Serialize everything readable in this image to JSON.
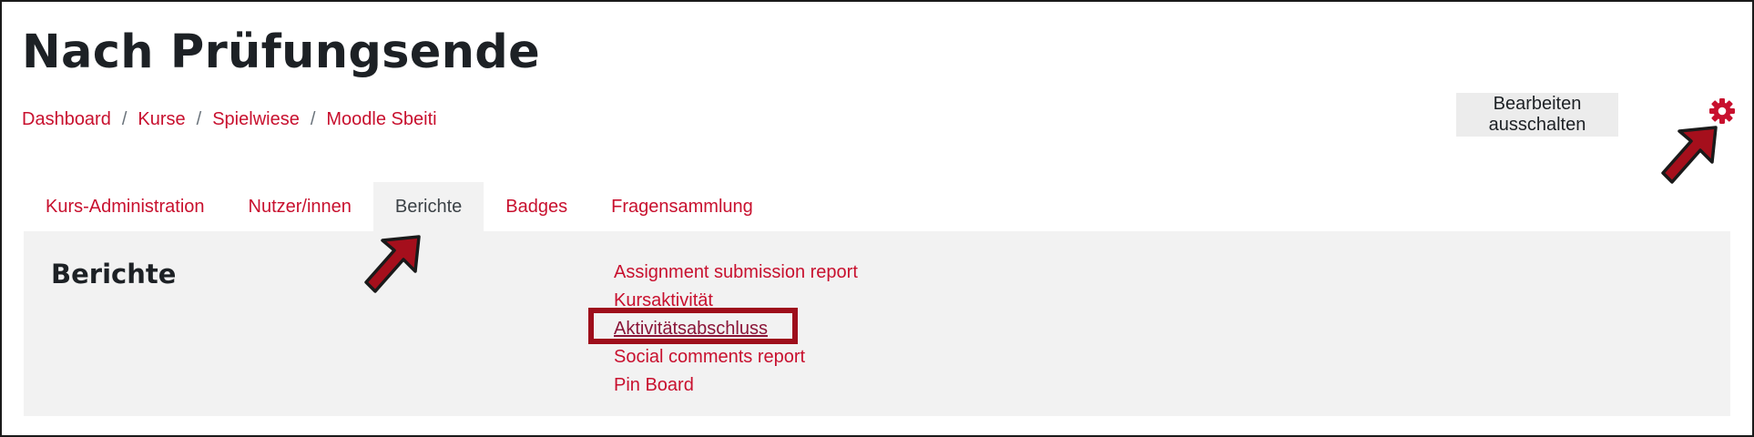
{
  "header": {
    "title": "Nach Prüfungsende"
  },
  "breadcrumb": [
    {
      "label": "Dashboard"
    },
    {
      "label": "Kurse"
    },
    {
      "label": "Spielwiese"
    },
    {
      "label": "Moodle Sbeiti"
    }
  ],
  "breadcrumb_separator": "/",
  "actions": {
    "edit_label": "Bearbeiten ausschalten",
    "settings_icon": "gear-icon"
  },
  "tabs": [
    {
      "label": "Kurs-Administration",
      "active": false
    },
    {
      "label": "Nutzer/innen",
      "active": false
    },
    {
      "label": "Berichte",
      "active": true
    },
    {
      "label": "Badges",
      "active": false
    },
    {
      "label": "Fragensammlung",
      "active": false
    }
  ],
  "panel": {
    "title": "Berichte",
    "links": [
      {
        "label": "Assignment submission report"
      },
      {
        "label": "Kursaktivität"
      },
      {
        "label": "Aktivitätsabschluss",
        "highlighted": true
      },
      {
        "label": "Social comments report"
      },
      {
        "label": "Pin Board"
      }
    ]
  },
  "colors": {
    "accent": "#c8102e",
    "annotation": "#a50f1c",
    "panel_bg": "#f2f2f2",
    "button_bg": "#ececec"
  }
}
